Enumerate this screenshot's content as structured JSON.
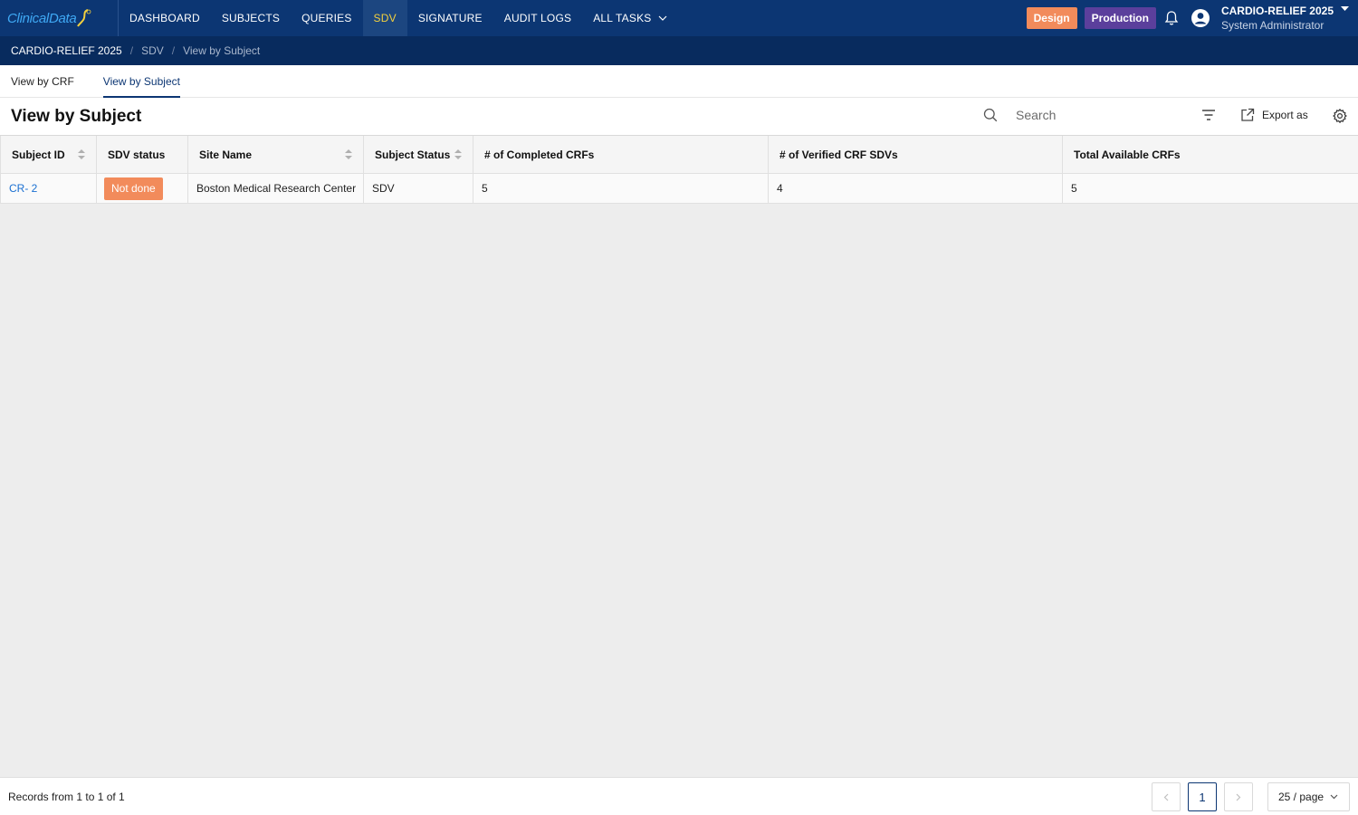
{
  "brand": {
    "logo_text": "ClinicalData"
  },
  "nav": {
    "items": [
      {
        "label": "DASHBOARD"
      },
      {
        "label": "SUBJECTS"
      },
      {
        "label": "QUERIES"
      },
      {
        "label": "SDV",
        "active": true
      },
      {
        "label": "SIGNATURE"
      },
      {
        "label": "AUDIT LOGS"
      },
      {
        "label": "ALL TASKS"
      }
    ]
  },
  "env": {
    "design": "Design",
    "production": "Production"
  },
  "user": {
    "study": "CARDIO-RELIEF 2025",
    "role": "System Administrator"
  },
  "breadcrumb": [
    "CARDIO-RELIEF 2025",
    "SDV",
    "View by Subject"
  ],
  "tabs": [
    {
      "label": "View by CRF"
    },
    {
      "label": "View by Subject",
      "active": true
    }
  ],
  "page": {
    "title": "View by Subject",
    "search_placeholder": "Search",
    "export_label": "Export as"
  },
  "table": {
    "columns": [
      "Subject ID",
      "SDV status",
      "Site Name",
      "Subject Status",
      "# of Completed CRFs",
      "# of Verified CRF SDVs",
      "Total Available CRFs"
    ],
    "rows": [
      {
        "subject_id": "CR- 2",
        "sdv_status": "Not done",
        "site_name": "Boston Medical Research Center",
        "subject_status": "SDV",
        "completed_crfs": "5",
        "verified_sdvs": "4",
        "total_crfs": "5"
      }
    ]
  },
  "footer": {
    "records_text": "Records from 1 to 1 of 1",
    "current_page": "1",
    "page_size": "25 / page"
  },
  "colors": {
    "nav_bg": "#0c3673",
    "accent_orange": "#f28b5b",
    "production_purple": "#5b3f9c",
    "active_nav_text": "#f3d03e",
    "link_blue": "#1a6fd1"
  }
}
